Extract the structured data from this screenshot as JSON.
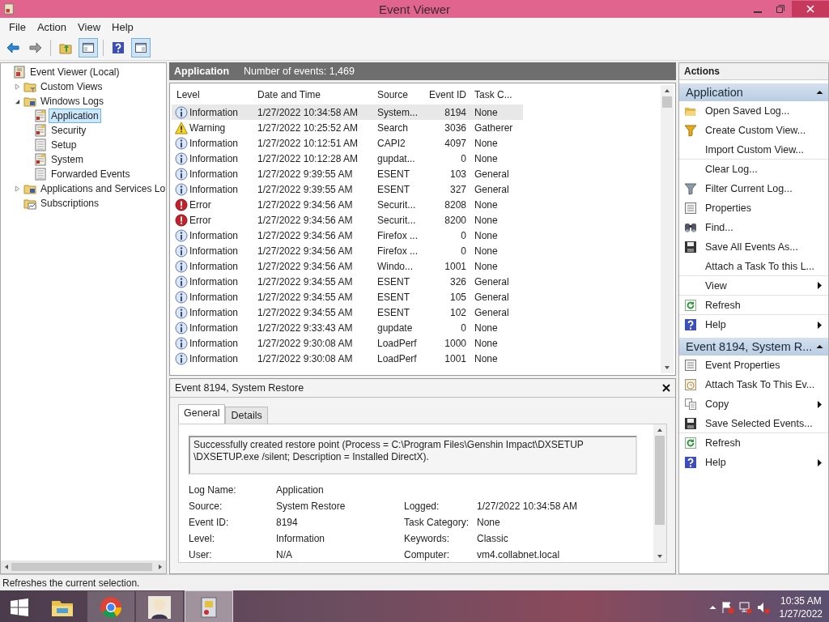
{
  "window": {
    "title": "Event Viewer"
  },
  "menu": [
    {
      "label": "File"
    },
    {
      "label": "Action"
    },
    {
      "label": "View"
    },
    {
      "label": "Help"
    }
  ],
  "toolbar": [
    {
      "kind": "back",
      "pressed": false
    },
    {
      "kind": "forward",
      "pressed": false
    },
    {
      "kind": "up",
      "pressed": false
    },
    {
      "kind": "tree-pane",
      "pressed": true
    },
    {
      "kind": "help",
      "pressed": false
    },
    {
      "kind": "action-pane",
      "pressed": true
    }
  ],
  "tree": {
    "items": [
      {
        "label": "Event Viewer (Local)",
        "kind": "root",
        "selected": false,
        "children": [
          {
            "label": "Custom Views",
            "kind": "filter-folder",
            "expanded": false,
            "selected": false
          },
          {
            "label": "Windows Logs",
            "kind": "folder",
            "expanded": true,
            "selected": false,
            "children": [
              {
                "label": "Application",
                "kind": "log",
                "selected": true
              },
              {
                "label": "Security",
                "kind": "log",
                "selected": false
              },
              {
                "label": "Setup",
                "kind": "plain-log",
                "selected": false
              },
              {
                "label": "System",
                "kind": "log",
                "selected": false
              },
              {
                "label": "Forwarded Events",
                "kind": "plain-log",
                "selected": false
              }
            ]
          },
          {
            "label": "Applications and Services Lo",
            "kind": "folder",
            "expanded": false,
            "selected": false
          },
          {
            "label": "Subscriptions",
            "kind": "subscriptions",
            "selected": false
          }
        ]
      }
    ]
  },
  "events": {
    "title": "Application",
    "count": "Number of events: 1,469",
    "columns": [
      "Level",
      "Date and Time",
      "Source",
      "Event ID",
      "Task C..."
    ],
    "rows": [
      {
        "kind": "information",
        "level_label": "Information",
        "date_time": "1/27/2022 10:34:58 AM",
        "source": "System...",
        "event_id": "8194",
        "task_category": "None",
        "selected": true
      },
      {
        "kind": "warning",
        "level_label": "Warning",
        "date_time": "1/27/2022 10:25:52 AM",
        "source": "Search",
        "event_id": "3036",
        "task_category": "Gatherer",
        "selected": false
      },
      {
        "kind": "information",
        "level_label": "Information",
        "date_time": "1/27/2022 10:12:51 AM",
        "source": "CAPI2",
        "event_id": "4097",
        "task_category": "None",
        "selected": false
      },
      {
        "kind": "information",
        "level_label": "Information",
        "date_time": "1/27/2022 10:12:28 AM",
        "source": "gupdat...",
        "event_id": "0",
        "task_category": "None",
        "selected": false
      },
      {
        "kind": "information",
        "level_label": "Information",
        "date_time": "1/27/2022 9:39:55 AM",
        "source": "ESENT",
        "event_id": "103",
        "task_category": "General",
        "selected": false
      },
      {
        "kind": "information",
        "level_label": "Information",
        "date_time": "1/27/2022 9:39:55 AM",
        "source": "ESENT",
        "event_id": "327",
        "task_category": "General",
        "selected": false
      },
      {
        "kind": "error",
        "level_label": "Error",
        "date_time": "1/27/2022 9:34:56 AM",
        "source": "Securit...",
        "event_id": "8208",
        "task_category": "None",
        "selected": false
      },
      {
        "kind": "error",
        "level_label": "Error",
        "date_time": "1/27/2022 9:34:56 AM",
        "source": "Securit...",
        "event_id": "8200",
        "task_category": "None",
        "selected": false
      },
      {
        "kind": "information",
        "level_label": "Information",
        "date_time": "1/27/2022 9:34:56 AM",
        "source": "Firefox ...",
        "event_id": "0",
        "task_category": "None",
        "selected": false
      },
      {
        "kind": "information",
        "level_label": "Information",
        "date_time": "1/27/2022 9:34:56 AM",
        "source": "Firefox ...",
        "event_id": "0",
        "task_category": "None",
        "selected": false
      },
      {
        "kind": "information",
        "level_label": "Information",
        "date_time": "1/27/2022 9:34:56 AM",
        "source": "Windo...",
        "event_id": "1001",
        "task_category": "None",
        "selected": false
      },
      {
        "kind": "information",
        "level_label": "Information",
        "date_time": "1/27/2022 9:34:55 AM",
        "source": "ESENT",
        "event_id": "326",
        "task_category": "General",
        "selected": false
      },
      {
        "kind": "information",
        "level_label": "Information",
        "date_time": "1/27/2022 9:34:55 AM",
        "source": "ESENT",
        "event_id": "105",
        "task_category": "General",
        "selected": false
      },
      {
        "kind": "information",
        "level_label": "Information",
        "date_time": "1/27/2022 9:34:55 AM",
        "source": "ESENT",
        "event_id": "102",
        "task_category": "General",
        "selected": false
      },
      {
        "kind": "information",
        "level_label": "Information",
        "date_time": "1/27/2022 9:33:43 AM",
        "source": "gupdate",
        "event_id": "0",
        "task_category": "None",
        "selected": false
      },
      {
        "kind": "information",
        "level_label": "Information",
        "date_time": "1/27/2022 9:30:08 AM",
        "source": "LoadPerf",
        "event_id": "1000",
        "task_category": "None",
        "selected": false
      },
      {
        "kind": "information",
        "level_label": "Information",
        "date_time": "1/27/2022 9:30:08 AM",
        "source": "LoadPerf",
        "event_id": "1001",
        "task_category": "None",
        "selected": false
      }
    ]
  },
  "detail": {
    "title": "Event 8194, System Restore",
    "tabs": [
      {
        "label": "General",
        "selected": true
      },
      {
        "label": "Details",
        "selected": false
      }
    ],
    "message": "Successfully created restore point (Process = C:\\Program Files\\Genshin Impact\\DXSETUP \\DXSETUP.exe  /silent; Description = Installed DirectX).",
    "rows": [
      {
        "left": {
          "label": "Log Name:",
          "value": "Application"
        }
      },
      {
        "left": {
          "label": "Source:",
          "value": "System Restore"
        },
        "right": {
          "label": "Logged:",
          "value": "1/27/2022 10:34:58 AM"
        }
      },
      {
        "left": {
          "label": "Event ID:",
          "value": "8194"
        },
        "right": {
          "label": "Task Category:",
          "value": "None"
        }
      },
      {
        "left": {
          "label": "Level:",
          "value": "Information"
        },
        "right": {
          "label": "Keywords:",
          "value": "Classic"
        }
      },
      {
        "left": {
          "label": "User:",
          "value": "N/A"
        },
        "right": {
          "label": "Computer:",
          "value": "vm4.collabnet.local"
        }
      }
    ]
  },
  "actions": {
    "title": "Actions",
    "sections": [
      {
        "title": "Application",
        "expanded": true,
        "items": [
          {
            "label": "Open Saved Log...",
            "kind": "open-folder",
            "submenu": false,
            "divider_after": false
          },
          {
            "label": "Create Custom View...",
            "kind": "funnel",
            "submenu": false,
            "divider_after": false
          },
          {
            "label": "Import Custom View...",
            "kind": "plain",
            "submenu": false,
            "divider_after": true
          },
          {
            "label": "Clear Log...",
            "kind": "plain",
            "submenu": false,
            "divider_after": false
          },
          {
            "label": "Filter Current Log...",
            "kind": "filter",
            "submenu": false,
            "divider_after": false
          },
          {
            "label": "Properties",
            "kind": "properties",
            "submenu": false,
            "divider_after": false
          },
          {
            "label": "Find...",
            "kind": "binoculars",
            "submenu": false,
            "divider_after": false
          },
          {
            "label": "Save All Events As...",
            "kind": "save",
            "submenu": false,
            "divider_after": false
          },
          {
            "label": "Attach a Task To this L...",
            "kind": "plain",
            "submenu": false,
            "divider_after": true
          },
          {
            "label": "View",
            "kind": "plain",
            "submenu": true,
            "divider_after": true
          },
          {
            "label": "Refresh",
            "kind": "refresh",
            "submenu": false,
            "divider_after": true
          },
          {
            "label": "Help",
            "kind": "help",
            "submenu": true,
            "divider_after": false
          }
        ]
      },
      {
        "title": "Event 8194, System R...",
        "expanded": true,
        "items": [
          {
            "label": "Event Properties",
            "kind": "properties",
            "submenu": false,
            "divider_after": false
          },
          {
            "label": "Attach Task To This Ev...",
            "kind": "task",
            "submenu": false,
            "divider_after": false
          },
          {
            "label": "Copy",
            "kind": "copy",
            "submenu": true,
            "divider_after": false
          },
          {
            "label": "Save Selected Events...",
            "kind": "save",
            "submenu": false,
            "divider_after": true
          },
          {
            "label": "Refresh",
            "kind": "refresh",
            "submenu": false,
            "divider_after": false
          },
          {
            "label": "Help",
            "kind": "help",
            "submenu": true,
            "divider_after": false
          }
        ]
      }
    ]
  },
  "status_bar": "Refreshes the current selection.",
  "taskbar": {
    "apps": [
      {
        "kind": "explorer",
        "running": false,
        "selected": false
      },
      {
        "kind": "chrome",
        "running": true,
        "selected": false
      },
      {
        "kind": "avatar",
        "running": true,
        "selected": false
      },
      {
        "kind": "event-viewer",
        "running": true,
        "selected": true
      }
    ],
    "time": "10:35 AM",
    "date": "1/27/2022"
  }
}
